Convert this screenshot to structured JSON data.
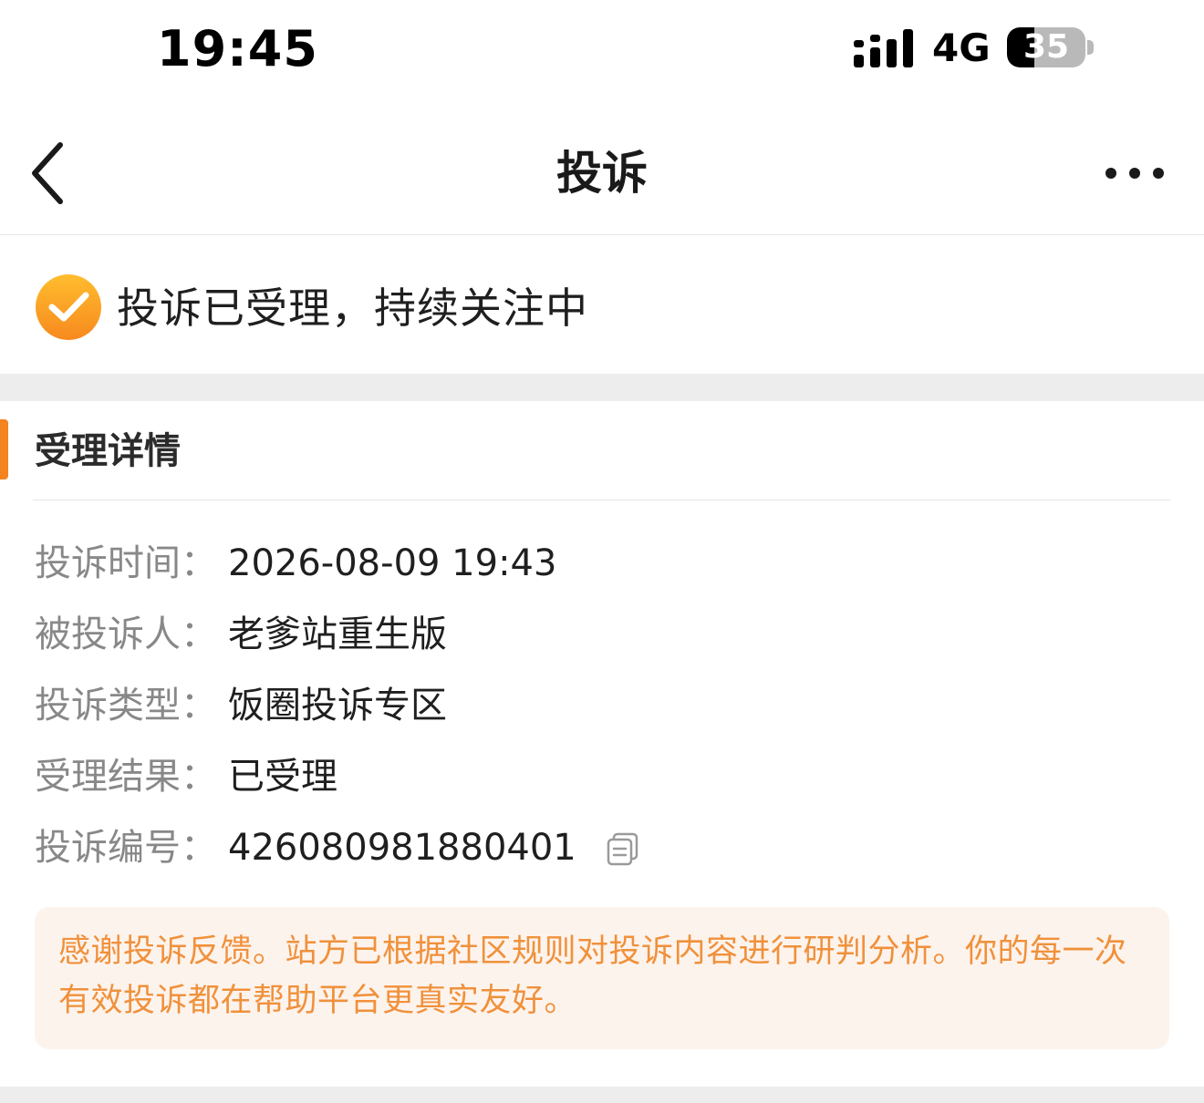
{
  "status_bar": {
    "time": "19:45",
    "network": "4G",
    "battery_percent": "35",
    "battery_level": 0.35
  },
  "nav": {
    "title": "投诉",
    "back_icon": "chevron-left-icon",
    "more_icon": "more-dots-icon"
  },
  "status": {
    "icon": "check-circle-icon",
    "text": "投诉已受理，持续关注中"
  },
  "details": {
    "section_title": "受理详情",
    "rows": [
      {
        "label": "投诉时间：",
        "value": "2026-08-09 19:43"
      },
      {
        "label": "被投诉人：",
        "value": "老爹站重生版"
      },
      {
        "label": "投诉类型：",
        "value": "饭圈投诉专区"
      },
      {
        "label": "受理结果：",
        "value": "已受理"
      },
      {
        "label": "投诉编号：",
        "value": "426080981880401"
      }
    ],
    "copy_icon": "copy-icon",
    "notice": "感谢投诉反馈。站方已根据社区规则对投诉内容进行研判分析。你的每一次有效投诉都在帮助平台更真实友好。"
  },
  "colors": {
    "accent": "#f5831f",
    "notice_text": "#f0913b",
    "notice_bg": "#fdf3ed",
    "label": "#888888"
  }
}
